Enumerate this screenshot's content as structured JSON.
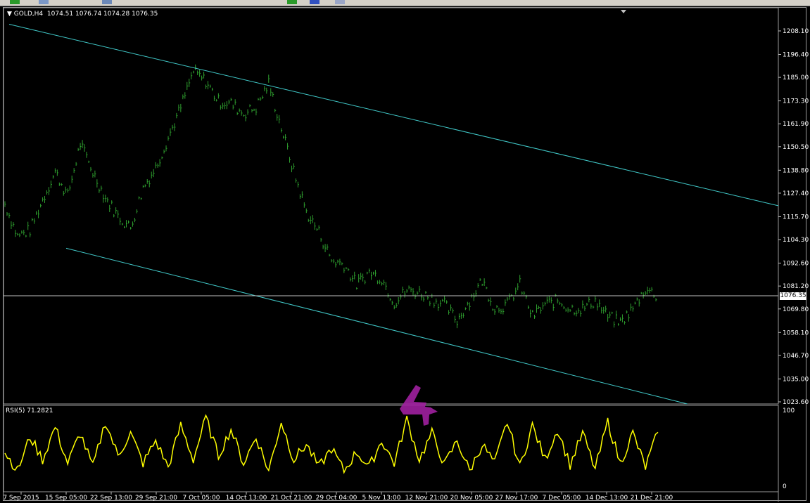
{
  "colors": {
    "background": "#000000",
    "bars": "#2e9e2e",
    "channel": "#40c8c8",
    "price_line": "#c0c0c0",
    "rsi_line": "#ffff00",
    "annotation": "#a020a0"
  },
  "header": {
    "symbol": "GOLD,H4",
    "ohlc": "1074.51 1076.74 1074.28 1076.35"
  },
  "rsi_panel": {
    "label": "RSI(5) 71.2821",
    "y_max_label": "100",
    "y_min_label": "0"
  },
  "current_price": "1076.35",
  "annotation_text": "4",
  "price_axis_labels": [
    "1208.10",
    "1196.40",
    "1185.00",
    "1173.30",
    "1161.90",
    "1150.50",
    "1138.80",
    "1127.40",
    "1115.70",
    "1104.30",
    "1092.60",
    "1081.20",
    "1069.80",
    "1058.10",
    "1046.70",
    "1035.00",
    "1023.60"
  ],
  "time_axis_labels": [
    "7 Sep 2015",
    "15 Sep 05:00",
    "22 Sep 13:00",
    "29 Sep 21:00",
    "7 Oct 05:00",
    "14 Oct 13:00",
    "21 Oct 21:00",
    "29 Oct 04:00",
    "5 Nov 13:00",
    "12 Nov 21:00",
    "20 Nov 05:00",
    "27 Nov 17:00",
    "7 Dec 05:00",
    "14 Dec 13:00",
    "21 Dec 21:00"
  ],
  "chart_data": [
    {
      "type": "line",
      "title": "GOLD,H4",
      "subtitle": "1074.51 1076.74 1074.28 1076.35",
      "xlabel": "",
      "ylabel": "",
      "grid": false,
      "ylim": [
        1023.6,
        1208.1
      ],
      "categories": [
        "7 Sep 2015",
        "15 Sep 05:00",
        "22 Sep 13:00",
        "29 Sep 21:00",
        "7 Oct 05:00",
        "14 Oct 13:00",
        "21 Oct 21:00",
        "29 Oct 04:00",
        "5 Nov 13:00",
        "12 Nov 21:00",
        "20 Nov 05:00",
        "27 Nov 17:00",
        "7 Dec 05:00",
        "14 Dec 13:00",
        "21 Dec 21:00"
      ],
      "series": [
        {
          "values": [
            1122,
            1106,
            1109,
            1124,
            1138,
            1126,
            1152,
            1138,
            1125,
            1116,
            1110,
            1130,
            1140,
            1155,
            1170,
            1188,
            1183,
            1173,
            1172,
            1167,
            1170,
            1182,
            1160,
            1138,
            1118,
            1108,
            1094,
            1092,
            1082,
            1088,
            1085,
            1073,
            1079,
            1078,
            1075,
            1072,
            1064,
            1074,
            1084,
            1070,
            1072,
            1082,
            1066,
            1072,
            1074,
            1070,
            1070,
            1074,
            1066,
            1063,
            1070,
            1080,
            1076
          ]
        }
      ],
      "price_channel": {
        "upper": {
          "from": {
            "x": "7 Sep 2015",
            "y": 1210
          },
          "to": {
            "x": "21 Dec 21:00",
            "y": 1136
          }
        },
        "lower": {
          "from": {
            "x": "15 Sep 05:00",
            "y": 1100
          },
          "to": {
            "x": "21 Dec 21:00",
            "y": 1027
          }
        }
      },
      "current_price_line": 1076.35
    },
    {
      "type": "line",
      "title": "RSI(5) 71.2821",
      "ylim": [
        0,
        100
      ],
      "categories": [
        "7 Sep 2015",
        "15 Sep 05:00",
        "22 Sep 13:00",
        "29 Sep 21:00",
        "7 Oct 05:00",
        "14 Oct 13:00",
        "21 Oct 21:00",
        "29 Oct 04:00",
        "5 Nov 13:00",
        "12 Nov 21:00",
        "20 Nov 05:00",
        "27 Nov 17:00",
        "7 Dec 05:00",
        "14 Dec 13:00",
        "21 Dec 21:00"
      ],
      "series": [
        {
          "values": [
            45,
            20,
            65,
            35,
            78,
            30,
            70,
            25,
            85,
            40,
            70,
            30,
            60,
            25,
            80,
            35,
            90,
            40,
            75,
            30,
            65,
            20,
            85,
            35,
            55,
            25,
            50,
            20,
            45,
            25,
            60,
            30,
            88,
            35,
            70,
            28,
            60,
            20,
            55,
            30,
            85,
            25,
            80,
            35,
            75,
            28,
            70,
            22,
            85,
            30,
            70,
            25,
            71
          ]
        }
      ]
    }
  ]
}
